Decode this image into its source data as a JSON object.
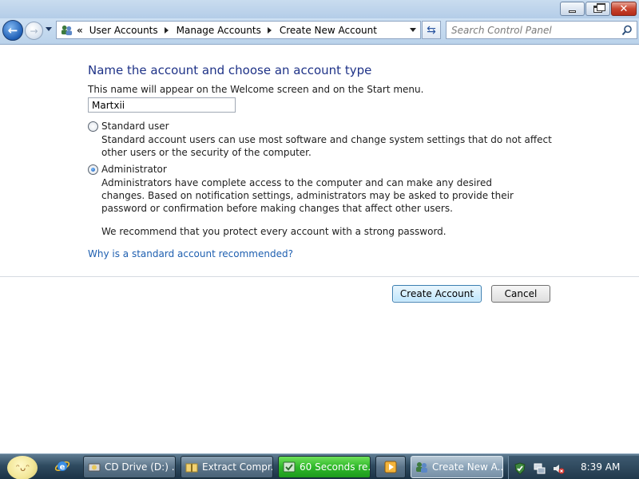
{
  "window": {
    "minimize_icon": "minimize-icon",
    "maximize_icon": "restore-icon",
    "close_icon": "close-icon"
  },
  "nav": {
    "back_icon": "back-arrow-icon",
    "forward_icon": "forward-arrow-icon",
    "breadcrumb_overflow": "«",
    "breadcrumbs": [
      "User Accounts",
      "Manage Accounts",
      "Create New Account"
    ],
    "search_placeholder": "Search Control Panel"
  },
  "main": {
    "heading": "Name the account and choose an account type",
    "subtext": "This name will appear on the Welcome screen and on the Start menu.",
    "account_name": "Martxii",
    "options": [
      {
        "label": "Standard user",
        "selected": false,
        "description": "Standard account users can use most software and change system settings that do not affect other users or the security of the computer."
      },
      {
        "label": "Administrator",
        "selected": true,
        "description": "Administrators have complete access to the computer and can make any desired changes. Based on notification settings, administrators may be asked to provide their password or confirmation before making changes that affect other users."
      }
    ],
    "recommendation": "We recommend that you protect every account with a strong password.",
    "help_link": "Why is a standard account recommended?",
    "create_button": "Create Account",
    "cancel_button": "Cancel"
  },
  "taskbar": {
    "items": [
      {
        "label": "CD Drive (D:) ...",
        "icon": "cd-drive-icon"
      },
      {
        "label": "Extract Compr...",
        "icon": "folder-zip-icon"
      },
      {
        "label": "60 Seconds re...",
        "icon": "timer-icon"
      },
      {
        "label": "",
        "icon": "media-player-icon"
      },
      {
        "label": "Create New A...",
        "icon": "user-accounts-icon"
      }
    ],
    "clock": "8:39 AM",
    "colors": {
      "taskbar": "#2f4b60",
      "progress_green": "#2fb82a",
      "link": "#1e5fb0",
      "heading": "#1e3287"
    }
  }
}
